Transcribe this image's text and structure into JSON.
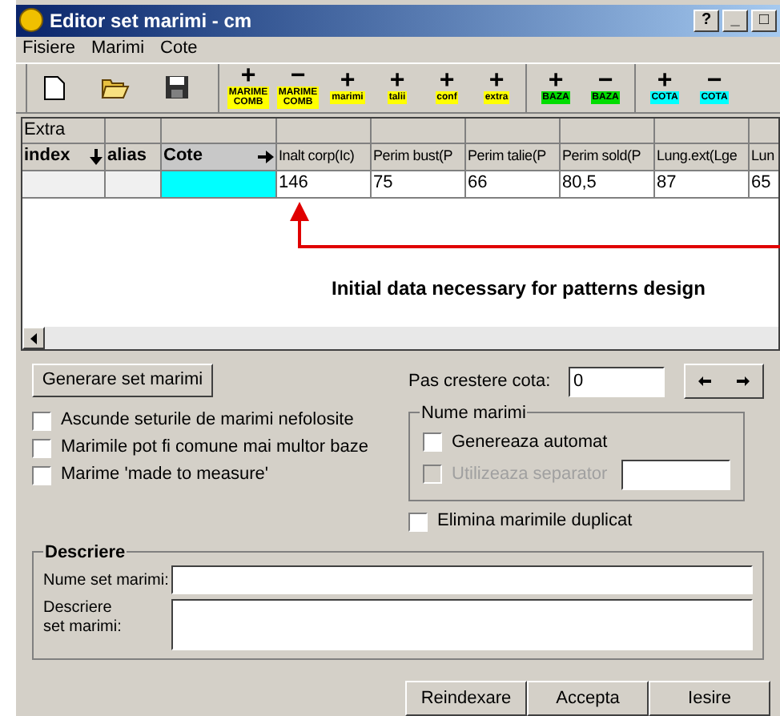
{
  "window": {
    "title": "Editor set marimi - cm",
    "title_buttons": [
      "?",
      "_",
      "□"
    ]
  },
  "menu": [
    "Fisiere",
    "Marimi",
    "Cote"
  ],
  "toolbar": {
    "file_buttons": [
      {
        "kind": "new"
      },
      {
        "kind": "open"
      },
      {
        "kind": "save"
      }
    ],
    "groups": [
      [
        {
          "sign": "+",
          "label": "MARIME COMB",
          "color": "#ffff00"
        },
        {
          "sign": "−",
          "label": "MARIME COMB",
          "color": "#ffff00"
        },
        {
          "sign": "+",
          "label": "marimi",
          "color": "#ffff00"
        },
        {
          "sign": "+",
          "label": "talii",
          "color": "#ffff00"
        },
        {
          "sign": "+",
          "label": "conf",
          "color": "#ffff00"
        },
        {
          "sign": "+",
          "label": "extra",
          "color": "#ffff00"
        }
      ],
      [
        {
          "sign": "+",
          "label": "BAZA",
          "color": "#00dd00"
        },
        {
          "sign": "−",
          "label": "BAZA",
          "color": "#00dd00"
        }
      ],
      [
        {
          "sign": "+",
          "label": "COTA",
          "color": "#00ffff"
        },
        {
          "sign": "−",
          "label": "COTA",
          "color": "#00ffff"
        }
      ]
    ]
  },
  "grid": {
    "group_header": "Extra",
    "columns": [
      "index",
      "alias",
      "Cote",
      "Inalt corp(Ic)",
      "Perim bust(P",
      "Perim talie(P",
      "Perim sold(P",
      "Lung.ext(Lge",
      "Lun"
    ],
    "rows": [
      [
        "",
        "",
        "",
        "146",
        "75",
        "66",
        "80,5",
        "87",
        "65"
      ]
    ]
  },
  "annotation": "Initial data necessary for patterns design",
  "generate_button": "Generare set marimi",
  "options": [
    {
      "label": "Ascunde seturile de marimi nefolosite",
      "checked": false
    },
    {
      "label": "Marimile pot fi comune mai multor baze",
      "checked": false
    },
    {
      "label": "Marime 'made to measure'",
      "checked": false
    }
  ],
  "step": {
    "label": "Pas crestere cota:",
    "value": "0"
  },
  "names_group": {
    "title": "Nume marimi",
    "options": [
      {
        "label": "Genereaza automat",
        "checked": false,
        "disabled": false
      },
      {
        "label": "Utilizeaza separator",
        "checked": false,
        "disabled": true
      }
    ]
  },
  "dedupe": {
    "label": "Elimina marimile duplicat",
    "checked": false
  },
  "description": {
    "title": "Descriere",
    "name_label": "Nume set marimi:",
    "desc_label": "Descriere set marimi:"
  },
  "buttons": [
    "Reindexare",
    "Accepta",
    "Iesire"
  ]
}
